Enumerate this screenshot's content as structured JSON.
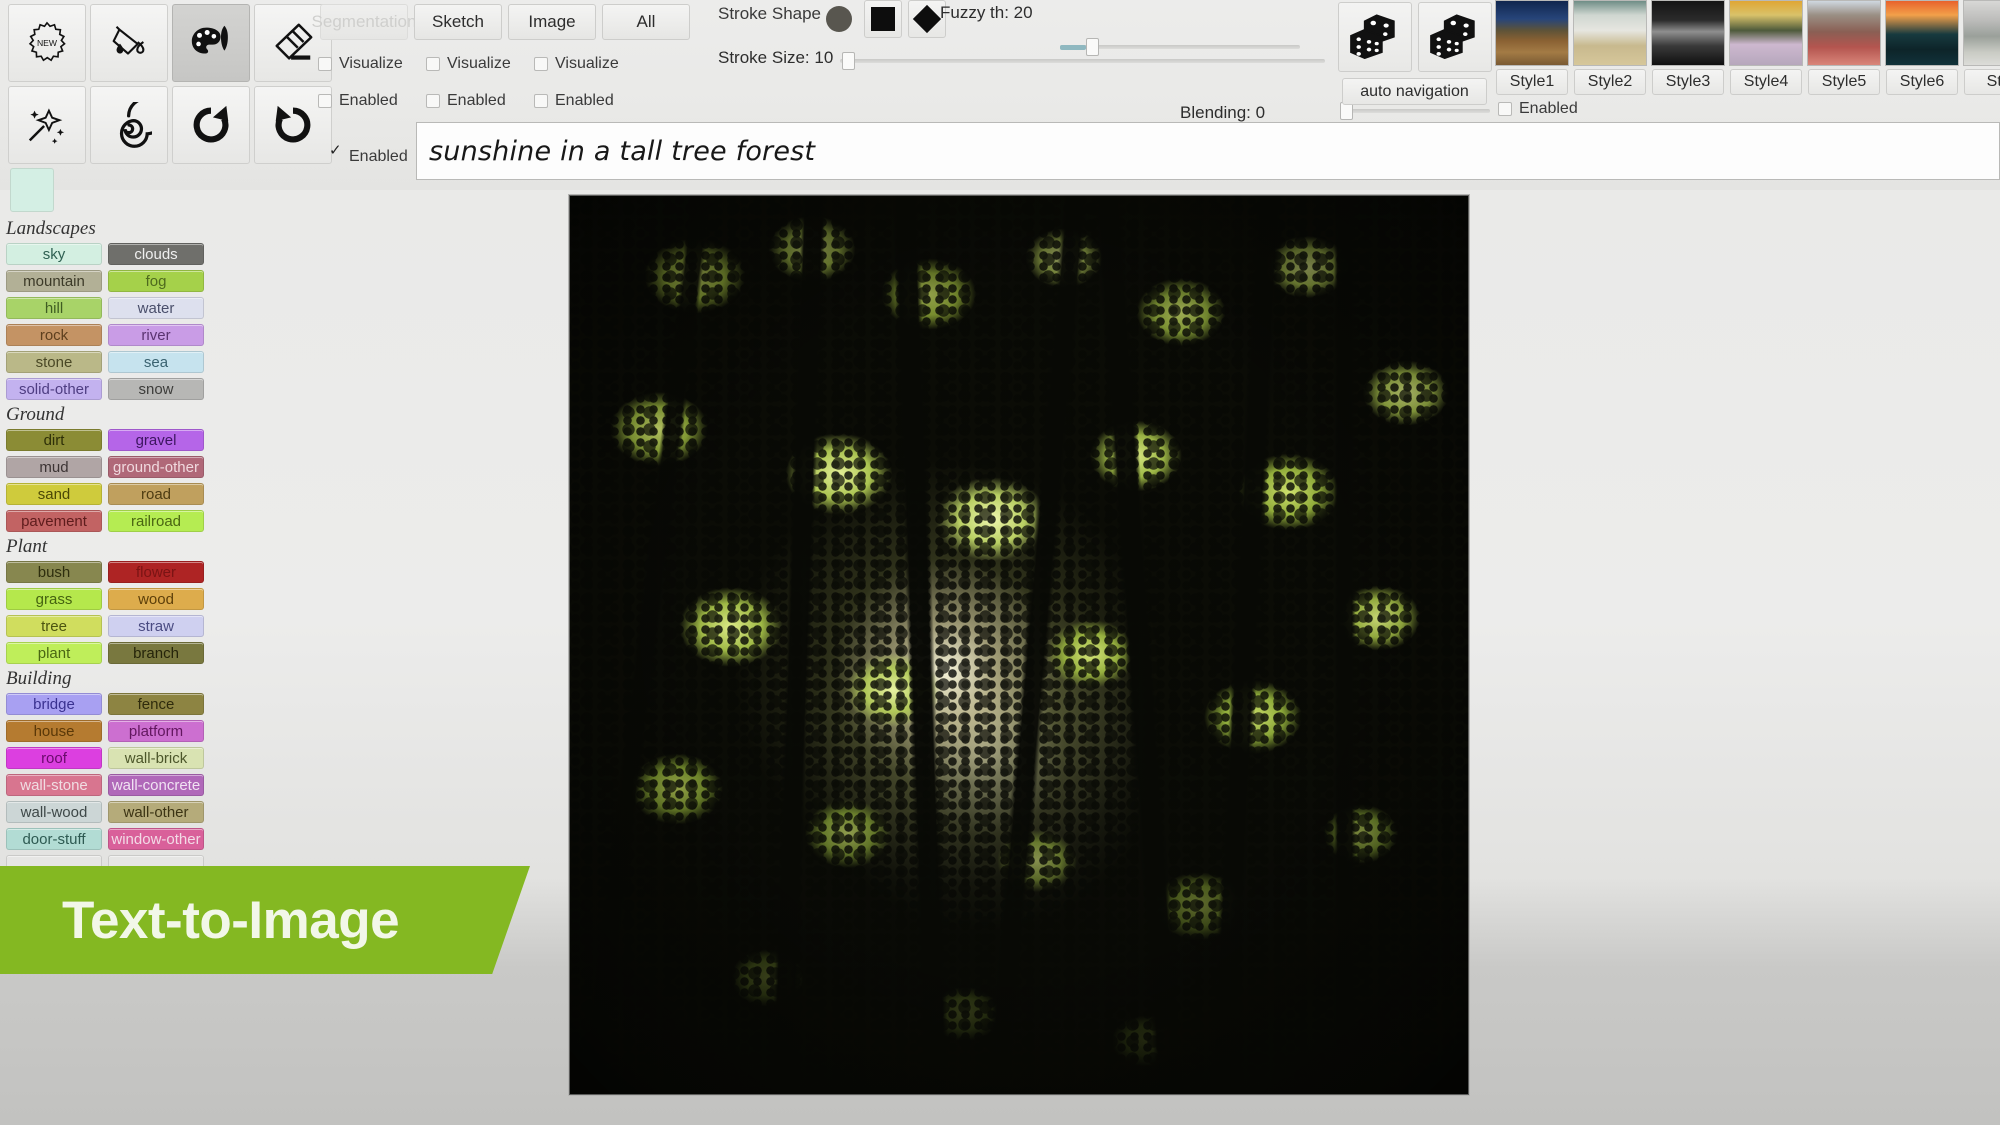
{
  "toolbar": {
    "tools_row1": [
      {
        "name": "new-tool",
        "icon": "new-badge-icon",
        "active": false
      },
      {
        "name": "fill-tool",
        "icon": "paint-bucket-icon",
        "active": false
      },
      {
        "name": "palette-tool",
        "icon": "palette-brush-icon",
        "active": true
      },
      {
        "name": "eraser-tool",
        "icon": "eraser-icon",
        "active": false
      }
    ],
    "tools_row2": [
      {
        "name": "magic-wand-tool",
        "icon": "magic-wand-icon",
        "active": false
      },
      {
        "name": "smudge-tool",
        "icon": "spiral-icon",
        "active": false
      },
      {
        "name": "redo-tool",
        "icon": "redo-arrow-icon",
        "active": false
      },
      {
        "name": "undo-tool",
        "icon": "undo-arrow-icon",
        "active": false
      }
    ],
    "current_color": "#d4efe4",
    "tabs": [
      {
        "label": "Segmentation",
        "disabled": true
      },
      {
        "label": "Sketch",
        "disabled": false
      },
      {
        "label": "Image",
        "disabled": false
      },
      {
        "label": "All",
        "disabled": false
      }
    ],
    "visualize_checks": [
      {
        "label": "Visualize",
        "checked": false
      },
      {
        "label": "Visualize",
        "checked": false
      },
      {
        "label": "Visualize",
        "checked": false
      }
    ],
    "enabled_checks": [
      {
        "label": "Enabled",
        "checked": false
      },
      {
        "label": "Enabled",
        "checked": false
      },
      {
        "label": "Enabled",
        "checked": false
      }
    ],
    "stroke_shape_label": "Stroke Shape",
    "stroke_shapes": [
      {
        "name": "circle-stroke-shape",
        "selected": false
      },
      {
        "name": "square-stroke-shape",
        "selected": true
      },
      {
        "name": "diamond-stroke-shape",
        "selected": false
      }
    ],
    "fuzzy_label": "Fuzzy th: 20",
    "fuzzy_value": 20,
    "stroke_size_label": "Stroke Size: 10",
    "stroke_size_value": 10,
    "blending_label": "Blending: 0",
    "blending_value": 0,
    "dice": [
      {
        "name": "dice-randomize-1",
        "icon": "dice-icon"
      },
      {
        "name": "dice-randomize-2",
        "icon": "dice-icon"
      }
    ],
    "auto_navigation_label": "auto navigation",
    "styles_enabled": {
      "label": "Enabled",
      "checked": false
    },
    "styles": [
      {
        "label": "Style1",
        "thumb_class": "th1"
      },
      {
        "label": "Style2",
        "thumb_class": "th2"
      },
      {
        "label": "Style3",
        "thumb_class": "th3"
      },
      {
        "label": "Style4",
        "thumb_class": "th4"
      },
      {
        "label": "Style5",
        "thumb_class": "th5"
      },
      {
        "label": "Style6",
        "thumb_class": "th6"
      },
      {
        "label": "Styl",
        "thumb_class": "th7"
      }
    ]
  },
  "prompt": {
    "enabled": {
      "label": "Enabled",
      "checked": true
    },
    "value": "sunshine in a tall tree forest",
    "placeholder": "sunshine in a tall tree forest"
  },
  "sidebar": {
    "groups": [
      {
        "title": "Landscapes",
        "rows": [
          [
            {
              "label": "sky",
              "color": "#d3efe1",
              "text": "#2f6052"
            },
            {
              "label": "clouds",
              "color": "#6f6f6b",
              "text": "#efefef"
            }
          ],
          [
            {
              "label": "mountain",
              "color": "#b2b096",
              "text": "#3c3a28"
            },
            {
              "label": "fog",
              "color": "#a5d14a",
              "text": "#4e6a1e"
            }
          ],
          [
            {
              "label": "hill",
              "color": "#a8d368",
              "text": "#3f5d22"
            },
            {
              "label": "water",
              "color": "#dde0ee",
              "text": "#4a4f6b"
            }
          ],
          [
            {
              "label": "rock",
              "color": "#c49364",
              "text": "#5d3f1e"
            },
            {
              "label": "river",
              "color": "#c99ce6",
              "text": "#5a3370"
            }
          ],
          [
            {
              "label": "stone",
              "color": "#bab888",
              "text": "#4a4826"
            },
            {
              "label": "sea",
              "color": "#c6e3ee",
              "text": "#3a6270"
            }
          ],
          [
            {
              "label": "solid-other",
              "color": "#c3b2ef",
              "text": "#4e3d82"
            },
            {
              "label": "snow",
              "color": "#b7b7b5",
              "text": "#3d3d3b"
            }
          ]
        ]
      },
      {
        "title": "Ground",
        "rows": [
          [
            {
              "label": "dirt",
              "color": "#8b8c35",
              "text": "#2e2f08"
            },
            {
              "label": "gravel",
              "color": "#b565e8",
              "text": "#3d1660"
            }
          ],
          [
            {
              "label": "mud",
              "color": "#b0a5a5",
              "text": "#3c3434"
            },
            {
              "label": "ground-other",
              "color": "#b06878",
              "text": "#f0d9de"
            }
          ],
          [
            {
              "label": "sand",
              "color": "#cfcb3c",
              "text": "#4b4806"
            },
            {
              "label": "road",
              "color": "#c0a05e",
              "text": "#4e3c12"
            }
          ],
          [
            {
              "label": "pavement",
              "color": "#c26363",
              "text": "#5e1c1c"
            },
            {
              "label": "railroad",
              "color": "#b5ec52",
              "text": "#4a6612"
            }
          ]
        ]
      },
      {
        "title": "Plant",
        "rows": [
          [
            {
              "label": "bush",
              "color": "#87874f",
              "text": "#2e2e0e"
            },
            {
              "label": "flower",
              "color": "#ae2424",
              "text": "#7a1414"
            }
          ],
          [
            {
              "label": "grass",
              "color": "#b5e84c",
              "text": "#456310"
            },
            {
              "label": "wood",
              "color": "#ddac4c",
              "text": "#5d3f0a"
            }
          ],
          [
            {
              "label": "tree",
              "color": "#d0dd5e",
              "text": "#4c5410"
            },
            {
              "label": "straw",
              "color": "#cfd0f0",
              "text": "#4a4b82"
            }
          ],
          [
            {
              "label": "plant",
              "color": "#bfee5a",
              "text": "#4a6613"
            },
            {
              "label": "branch",
              "color": "#79783f",
              "text": "#25240a"
            }
          ]
        ]
      },
      {
        "title": "Building",
        "rows": [
          [
            {
              "label": "bridge",
              "color": "#a8a0f2",
              "text": "#3a3190"
            },
            {
              "label": "fence",
              "color": "#8d8442",
              "text": "#2f2b0c"
            }
          ],
          [
            {
              "label": "house",
              "color": "#b57b30",
              "text": "#5a3808"
            },
            {
              "label": "platform",
              "color": "#cc6fd0",
              "text": "#62175f"
            }
          ],
          [
            {
              "label": "roof",
              "color": "#dc3fe0",
              "text": "#6a0a6c"
            },
            {
              "label": "wall-brick",
              "color": "#d9e3b2",
              "text": "#4c562a"
            }
          ],
          [
            {
              "label": "wall-stone",
              "color": "#d8758f",
              "text": "#f0dde2"
            },
            {
              "label": "wall-concrete",
              "color": "#b068b9",
              "text": "#f0e2f2"
            }
          ],
          [
            {
              "label": "wall-wood",
              "color": "#ccd6d6",
              "text": "#3e4848"
            },
            {
              "label": "wall-other",
              "color": "#b5ab7a",
              "text": "#3c3414"
            }
          ],
          [
            {
              "label": "door-stuff",
              "color": "#b2dcd4",
              "text": "#2e5a52"
            },
            {
              "label": "window-other",
              "color": "#d9609a",
              "text": "#f2dbe6"
            }
          ]
        ]
      }
    ]
  },
  "banner": {
    "text": "Text-to-Image",
    "color": "#84b822"
  },
  "canvas": {
    "alt": "generated forest canopy image with sunlight"
  }
}
